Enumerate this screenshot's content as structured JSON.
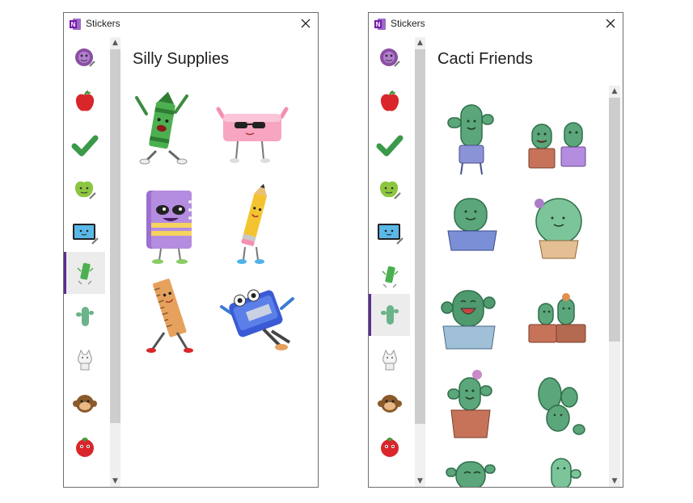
{
  "windows": [
    {
      "title": "Stickers",
      "section_title": "Silly Supplies",
      "active_category": "silly-supplies",
      "categories": [
        "emoji-purple",
        "apple",
        "checkmark",
        "apple-face",
        "monitor",
        "silly-supplies",
        "cacti-friends",
        "cat",
        "monkey",
        "tomato",
        "comic"
      ],
      "stickers": [
        "crayon-sticker",
        "eraser-sticker",
        "notebook-sticker",
        "pencil-sticker",
        "ruler-sticker",
        "sharpener-sticker"
      ]
    },
    {
      "title": "Stickers",
      "section_title": "Cacti Friends",
      "active_category": "cacti-friends",
      "categories": [
        "emoji-purple",
        "apple",
        "checkmark",
        "apple-face",
        "monitor",
        "silly-supplies",
        "cacti-friends",
        "cat",
        "monkey",
        "tomato",
        "comic"
      ],
      "stickers": [
        "cactus-sticker-1",
        "cactus-sticker-2",
        "cactus-sticker-3",
        "cactus-sticker-4",
        "cactus-sticker-5",
        "cactus-sticker-6",
        "cactus-sticker-7",
        "cactus-sticker-8",
        "cactus-sticker-9",
        "cactus-sticker-10"
      ]
    }
  ],
  "colors": {
    "accent": "#5c2d91",
    "cactus": "#4f9a6e",
    "border": "#6e6e6e"
  }
}
